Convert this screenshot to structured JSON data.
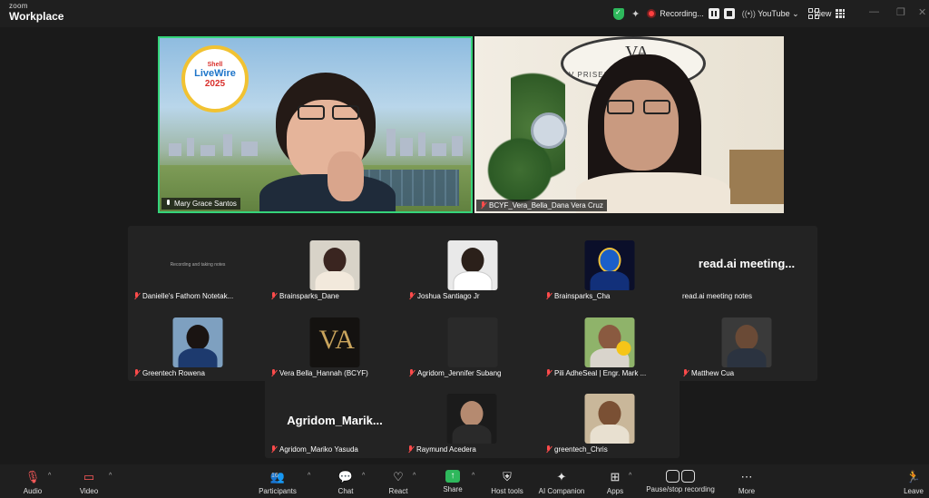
{
  "app": {
    "brand_top": "zoom",
    "brand_bottom": "Workplace"
  },
  "topbar": {
    "recording_label": "Recording...",
    "live_label": "YouTube",
    "view_label": "View",
    "colors": {
      "secure": "#2eb85c",
      "record": "#ff4040"
    }
  },
  "speakers": [
    {
      "name": "Mary Grace Santos",
      "logo": {
        "line1": "Shell",
        "line2": "LiveWire",
        "line3": "2025"
      }
    },
    {
      "name": "BCYF_Vera_Bella_Dana Vera Cruz",
      "sign_mark": "VA",
      "sign_text": "V            PRISES"
    }
  ],
  "gallery": {
    "row1": [
      {
        "name": "Danielle's Fathom Notetak...",
        "caption": "Recording and taking notes"
      },
      {
        "name": "Brainsparks_Dane"
      },
      {
        "name": "Joshua Santiago Jr"
      },
      {
        "name": "Brainsparks_Cha"
      },
      {
        "name": "read.ai meeting notes",
        "big": "read.ai  meeting..."
      }
    ],
    "row2": [
      {
        "name": "Greentech Rowena"
      },
      {
        "name": "Vera Bella_Hannah (BCYF)"
      },
      {
        "name": "Agridom_Jennifer Subang"
      },
      {
        "name": "Pili AdheSeal | Engr. Mark ..."
      },
      {
        "name": "Matthew Cua"
      }
    ],
    "row3": [
      {
        "name": "Agridom_Mariko Yasuda",
        "big": "Agridom_Marik..."
      },
      {
        "name": "Raymund Acedera"
      },
      {
        "name": "greentech_Chris"
      }
    ]
  },
  "toolbar": {
    "audio": "Audio",
    "video": "Video",
    "participants": "Participants",
    "participants_count": "16",
    "chat": "Chat",
    "react": "React",
    "share": "Share",
    "host_tools": "Host tools",
    "ai_companion": "AI Companion",
    "apps": "Apps",
    "pause_stop": "Pause/stop recording",
    "more": "More",
    "leave": "Leave"
  }
}
